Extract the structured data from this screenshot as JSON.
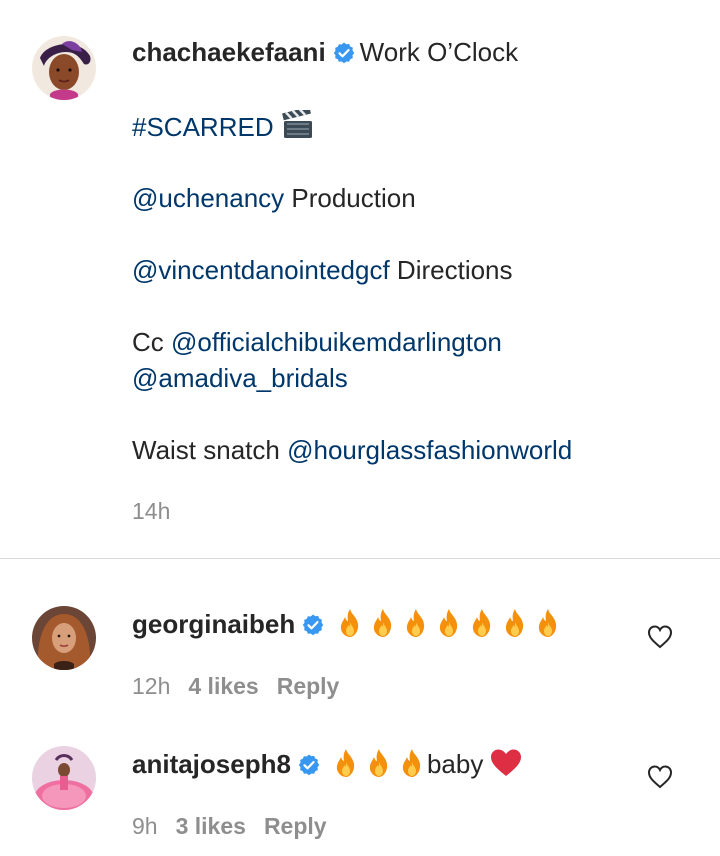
{
  "post": {
    "username": "chachaekefaani",
    "caption_first": "Work O’Clock",
    "hashtag": "#SCARRED",
    "line_production_mention": "@uchenancy",
    "line_production_text": "Production",
    "line_directions_mention": "@vincentdanointedgcf",
    "line_directions_text": "Directions",
    "cc_prefix": "Cc",
    "cc_mention_1": "@officialchibuikemdarlington",
    "cc_mention_2": "@amadiva_bridals",
    "waist_prefix": "Waist snatch",
    "waist_mention": "@hourglassfashionworld",
    "time": "14h",
    "clapper_icon": "clapper-board-icon"
  },
  "comments": [
    {
      "username": "georginaibeh",
      "emoji_icons": [
        "fire-icon",
        "fire-icon",
        "fire-icon",
        "fire-icon",
        "fire-icon",
        "fire-icon",
        "fire-icon"
      ],
      "text": "",
      "time": "12h",
      "likes": "4 likes",
      "reply": "Reply"
    },
    {
      "username": "anitajoseph8",
      "emoji_icons": [
        "fire-icon",
        "fire-icon",
        "fire-icon"
      ],
      "text": "baby",
      "trailing_icon": "red-heart-icon",
      "time": "9h",
      "likes": "3 likes",
      "reply": "Reply"
    }
  ],
  "colors": {
    "mention": "#00376b",
    "verified": "#3897f0",
    "muted": "#8e8e8e",
    "text": "#262626"
  }
}
